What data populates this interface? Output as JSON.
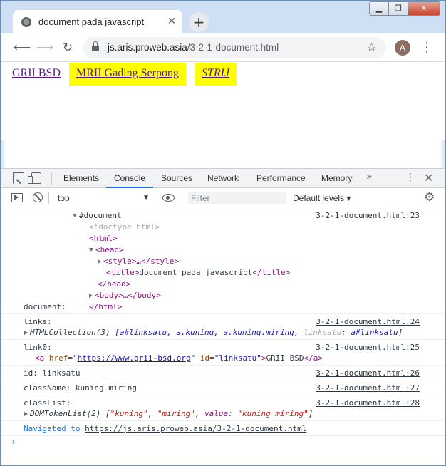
{
  "browser": {
    "tab_title": "document pada javascript",
    "tab_close": "✕",
    "new_tab": "+",
    "url_host": "js.aris.proweb.asia",
    "url_path": "/3-2-1-document.html",
    "avatar_letter": "A",
    "window_controls": {
      "minimize": "▁",
      "maximize": "❐",
      "close": "✕"
    }
  },
  "page": {
    "links": [
      {
        "text": "GRII BSD"
      },
      {
        "text": "MRII Gading Serpong"
      },
      {
        "text": "STRIJ"
      }
    ],
    "highlight_color": "#ffff00"
  },
  "devtools": {
    "tabs": [
      "Elements",
      "Console",
      "Sources",
      "Network",
      "Performance",
      "Memory"
    ],
    "active_tab": "Console",
    "more_tabs": "»",
    "context": "top",
    "filter_placeholder": "Filter",
    "levels": "Default levels ▾",
    "console": {
      "msg1": {
        "label": "document:",
        "source": "3-2-1-document.html:23",
        "root": "#document",
        "doctype": "<!doctype html>",
        "html_open": "<html>",
        "head_open": "<head>",
        "style": "<style>…</style>",
        "title_open": "<title>",
        "title_text": "document pada javascript",
        "title_close": "</title>",
        "head_close": "</head>",
        "body": "<body>…</body>",
        "html_close": "</html>"
      },
      "msg2": {
        "label": "links:",
        "source": "3-2-1-document.html:24",
        "type": "HTMLCollection(3)",
        "items": "[a#linksatu, a.kuning, a.kuning.miring, ",
        "named_key": "linksatu",
        "named_sep": ": ",
        "named_val": "a#linksatu",
        "close": "]"
      },
      "msg3": {
        "label": "link0:",
        "source": "3-2-1-document.html:25",
        "a_open": "<a ",
        "href_attr": "href",
        "href_val": "https://www.grii-bsd.org",
        "id_attr": "id",
        "id_val": "\"linksatu\"",
        "text": "GRII BSD",
        "a_close": "</a>"
      },
      "msg4": {
        "text": "id: linksatu",
        "source": "3-2-1-document.html:26"
      },
      "msg5": {
        "text": "className: kuning miring",
        "source": "3-2-1-document.html:27"
      },
      "msg6": {
        "label": "classList:",
        "source": "3-2-1-document.html:28",
        "type": "DOMTokenList(2)",
        "token1": "\"kuning\"",
        "token2": "\"miring\"",
        "value_key": "value",
        "value_val": "\"kuning miring\""
      },
      "navigated": {
        "prefix": "Navigated to",
        "url": "https://js.aris.proweb.asia/3-2-1-document.html"
      },
      "prompt": "›"
    }
  }
}
